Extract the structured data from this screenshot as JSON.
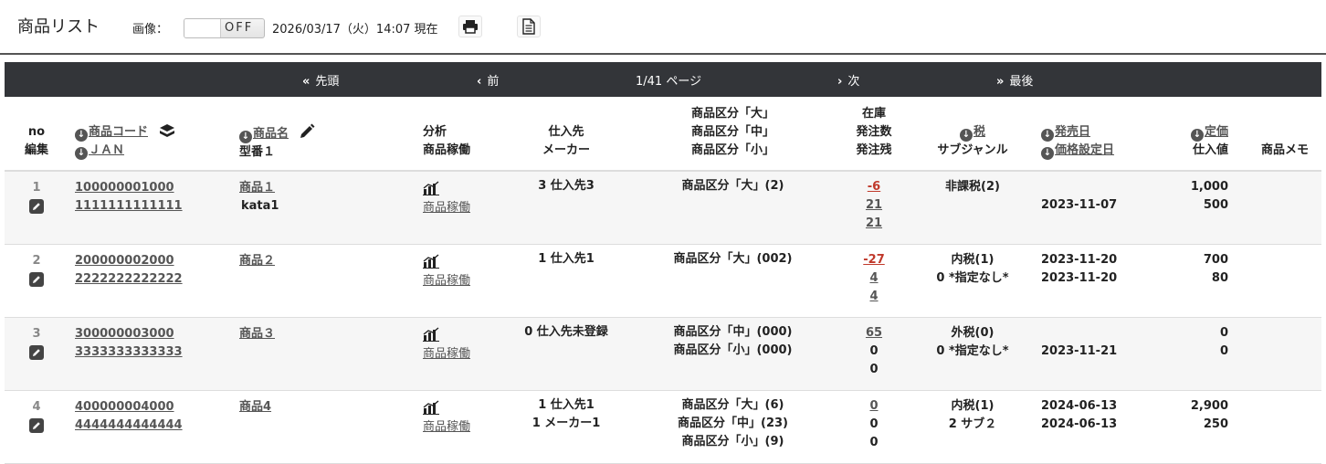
{
  "header": {
    "title": "商品リスト",
    "image_label": "画像：",
    "toggle_text": "OFF",
    "now": "2026/03/17（火）14:07 現在"
  },
  "nav": {
    "first": "先頭",
    "prev": "前",
    "page": "1/41 ページ",
    "next": "次",
    "last": "最後"
  },
  "columns": {
    "no": "no",
    "edit": "編集",
    "code": "商品コード",
    "jan": "ＪＡＮ",
    "name": "商品名",
    "model": "型番１",
    "analysis": "分析",
    "operation": "商品稼働",
    "supplier": "仕入先",
    "maker": "メーカー",
    "cat_l": "商品区分「大」",
    "cat_m": "商品区分「中」",
    "cat_s": "商品区分「小」",
    "stock": "在庫",
    "order_qty": "発注数",
    "order_rem": "発注残",
    "tax": "税",
    "subgenre": "サブジャンル",
    "release": "発売日",
    "price_date": "価格設定日",
    "list_price": "定価",
    "cost": "仕入値",
    "memo": "商品メモ"
  },
  "rows": [
    {
      "no": "1",
      "code": "100000001000",
      "jan": "1111111111111",
      "name": "商品１",
      "model": "kata1",
      "op": "商品稼働",
      "sup1": "3 仕入先3",
      "sup2": "",
      "cat1": "商品区分「大」(2)",
      "cat2": "",
      "cat3": "",
      "stock": "-6",
      "oq": "21",
      "or": "21",
      "tax": "非課税(2)",
      "sub": "",
      "rel": "",
      "pdate": "2023-11-07",
      "price": "1,000",
      "cost": "500"
    },
    {
      "no": "2",
      "code": "200000002000",
      "jan": "2222222222222",
      "name": "商品２",
      "model": "",
      "op": "商品稼働",
      "sup1": "1 仕入先1",
      "sup2": "",
      "cat1": "商品区分「大」(002)",
      "cat2": "",
      "cat3": "",
      "stock": "-27",
      "oq": "4",
      "or": "4",
      "tax": "内税(1)",
      "sub": "0 *指定なし*",
      "rel": "2023-11-20",
      "pdate": "2023-11-20",
      "price": "700",
      "cost": "80"
    },
    {
      "no": "3",
      "code": "300000003000",
      "jan": "3333333333333",
      "name": "商品３",
      "model": "",
      "op": "商品稼働",
      "sup1": "0 仕入先未登録",
      "sup2": "",
      "cat1": "",
      "cat2": "商品区分「中」(000)",
      "cat3": "商品区分「小」(000)",
      "stock": "65",
      "oq": "0",
      "or": "0",
      "tax": "外税(0)",
      "sub": "0 *指定なし*",
      "rel": "",
      "pdate": "2023-11-21",
      "price": "0",
      "cost": "0"
    },
    {
      "no": "4",
      "code": "400000004000",
      "jan": "4444444444444",
      "name": "商品4",
      "model": "",
      "op": "商品稼働",
      "sup1": "1 仕入先1",
      "sup2": "1 メーカー1",
      "cat1": "商品区分「大」(6)",
      "cat2": "商品区分「中」(23)",
      "cat3": "商品区分「小」(9)",
      "stock": "0",
      "oq": "0",
      "or": "0",
      "tax": "内税(1)",
      "sub": "2 サブ２",
      "rel": "2024-06-13",
      "pdate": "2024-06-13",
      "price": "2,900",
      "cost": "250"
    }
  ]
}
